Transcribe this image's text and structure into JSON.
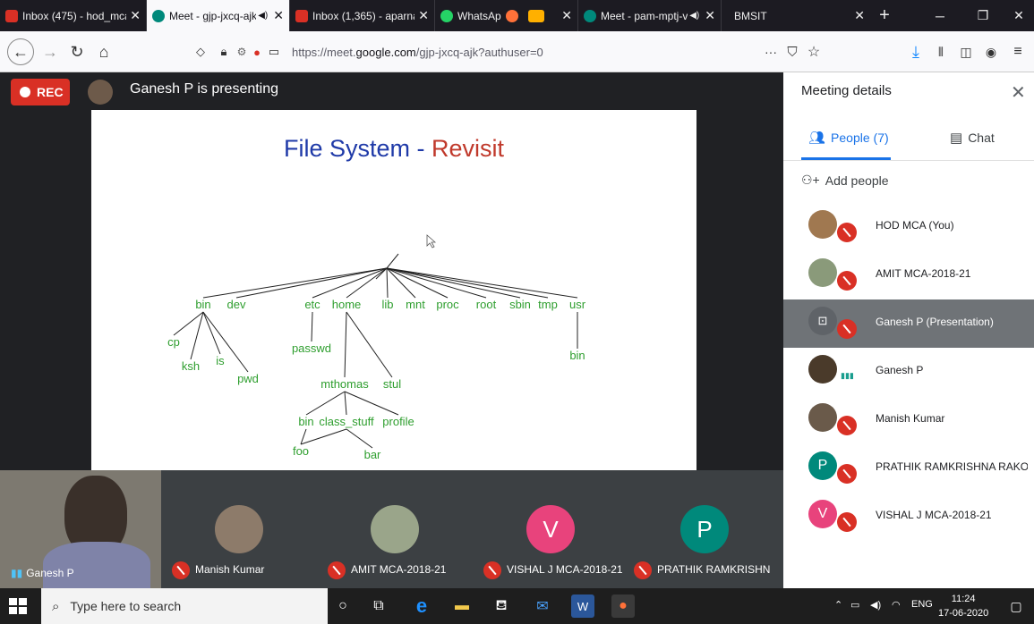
{
  "browser": {
    "tabs": [
      {
        "title": "Inbox (475) - hod_mca",
        "icon": "gmail-icon",
        "color": "#d93025",
        "active": false,
        "sound": false
      },
      {
        "title": "Meet - gjp-jxcq-ajk",
        "icon": "meet-icon",
        "color": "#00897b",
        "active": true,
        "sound": true
      },
      {
        "title": "Inbox (1,365) - aparna",
        "icon": "gmail-icon",
        "color": "#d93025",
        "active": false,
        "sound": false
      },
      {
        "title": "WhatsAp",
        "icon": "whatsapp-icon",
        "color": "#25d366",
        "active": false,
        "sound": false
      },
      {
        "title": "Meet - pam-mptj-v",
        "icon": "meet-icon",
        "color": "#00897b",
        "active": false,
        "sound": true
      },
      {
        "title": "BMSIT",
        "icon": "bmsit-icon",
        "color": "#1c1b22",
        "active": false,
        "sound": false
      }
    ],
    "url_prefix": "https://meet.",
    "url_domain": "google.com",
    "url_suffix": "/gjp-jxcq-ajk?authuser=0",
    "nav_more": "···"
  },
  "meet": {
    "rec_label": "REC",
    "presenting_text": "Ganesh P is presenting",
    "slide": {
      "title_part1": "File System - ",
      "title_part2": "Revisit",
      "title_color1": "#1f3aa8",
      "title_color2": "#c0392b",
      "node_color": "#2e9e2e",
      "labels": {
        "bin": "bin",
        "dev": "dev",
        "etc": "etc",
        "home": "home",
        "lib": "lib",
        "mnt": "mnt",
        "proc": "proc",
        "root": "root",
        "sbin": "sbin",
        "tmp": "tmp",
        "usr": "usr",
        "cp": "cp",
        "ksh": "ksh",
        "is": "is",
        "pwd": "pwd",
        "passwd": "passwd",
        "usr_bin": "bin",
        "mthomas": "mthomas",
        "stul": "stul",
        "mt_bin": "bin",
        "class_stuff": "class_stuff",
        "profile": "profile",
        "foo": "foo",
        "bar": "bar"
      }
    },
    "tiles": [
      {
        "name": "Ganesh P",
        "self": true
      },
      {
        "name": "Manish Kumar",
        "muted": true
      },
      {
        "name": "AMIT MCA-2018-21",
        "muted": true
      },
      {
        "name": "VISHAL J MCA-2018-21",
        "muted": true,
        "initial": "V",
        "color": "#e8437c"
      },
      {
        "name": "PRATHIK RAMKRISHN",
        "muted": true,
        "initial": "P",
        "color": "#00897b"
      }
    ]
  },
  "panel": {
    "title": "Meeting details",
    "tab_people": "People (7)",
    "tab_chat": "Chat",
    "add_people": "Add people",
    "people": [
      {
        "name": "HOD MCA (You)",
        "muted": true,
        "color": "#a07850"
      },
      {
        "name": "AMIT MCA-2018-21",
        "muted": true,
        "color": "#8a9a7a"
      },
      {
        "name": "Ganesh P (Presentation)",
        "muted": true,
        "highlight": true,
        "color": "#5f6368"
      },
      {
        "name": "Ganesh P",
        "speaking": true,
        "color": "#4a3a2a"
      },
      {
        "name": "Manish Kumar",
        "muted": true,
        "color": "#6a5a4a"
      },
      {
        "name": "PRATHIK RAMKRISHNA RAKO...",
        "muted": true,
        "initial": "P",
        "color": "#00897b"
      },
      {
        "name": "VISHAL J MCA-2018-21",
        "muted": true,
        "initial": "V",
        "color": "#e8437c"
      }
    ]
  },
  "taskbar": {
    "search_placeholder": "Type here to search",
    "language": "ENG",
    "time": "11:24",
    "date": "17-06-2020"
  }
}
